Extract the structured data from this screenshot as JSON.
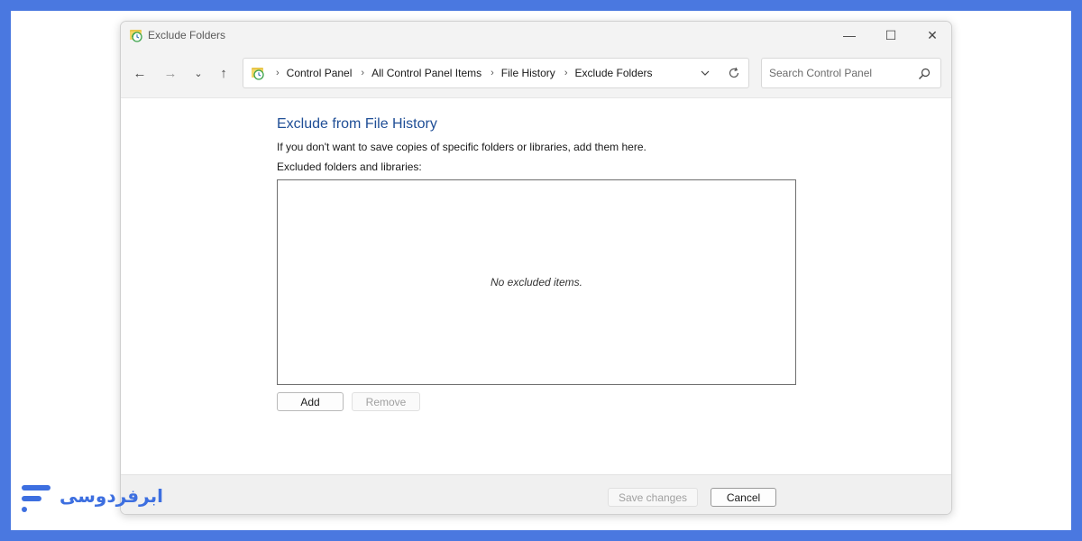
{
  "window": {
    "title": "Exclude Folders",
    "controls": {
      "minimize": "—",
      "maximize": "☐",
      "close": "✕"
    }
  },
  "navigation": {
    "back": "←",
    "forward": "→",
    "recent": "⌄",
    "up": "↑"
  },
  "address": {
    "breadcrumbs": [
      "Control Panel",
      "All Control Panel Items",
      "File History",
      "Exclude Folders"
    ],
    "separator": "›"
  },
  "search": {
    "placeholder": "Search Control Panel"
  },
  "content": {
    "heading": "Exclude from File History",
    "description": "If you don't want to save copies of specific folders or libraries, add them here.",
    "list_label": "Excluded folders and libraries:",
    "empty_text": "No excluded items.",
    "add_label": "Add",
    "remove_label": "Remove"
  },
  "footer": {
    "save_label": "Save changes",
    "cancel_label": "Cancel"
  },
  "brand": {
    "name": "ابرفردوسی"
  },
  "colors": {
    "background_blue": "#4a78e0",
    "heading_blue": "#1f4e96",
    "brand_blue": "#3d6fe0"
  }
}
